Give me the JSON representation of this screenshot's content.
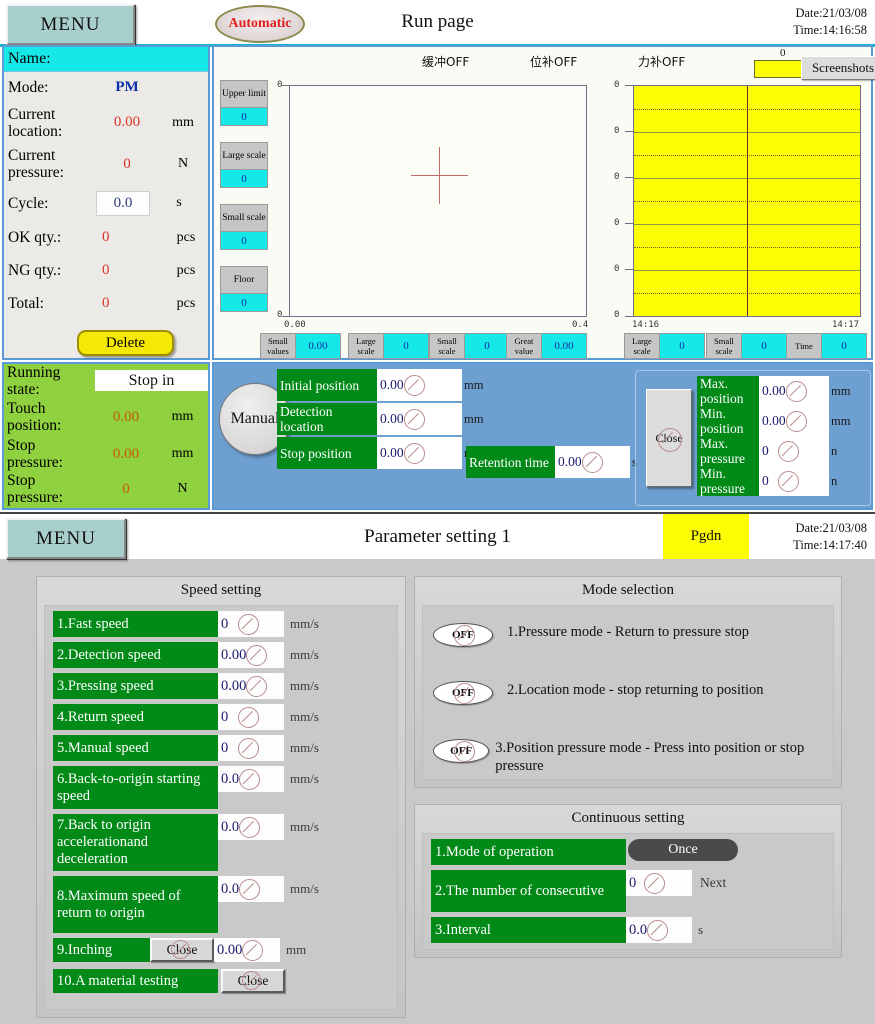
{
  "window1": {
    "menu_label": "MENU",
    "mode_button": "Automatic",
    "title": "Run page",
    "date_label": "Date:",
    "date_value": "21/03/08",
    "time_label": "Time:",
    "time_value": "14:16:58",
    "info": {
      "name_label": "Name:",
      "name_value": "",
      "rows": [
        {
          "label": "Mode:",
          "value": "PM",
          "unit": "",
          "style": "blue"
        },
        {
          "label": "Current location:",
          "value": "0.00",
          "unit": "mm",
          "style": "red"
        },
        {
          "label": "Current pressure:",
          "value": "0",
          "unit": "N",
          "style": "red"
        },
        {
          "label": "Cycle:",
          "value": "0.0",
          "unit": "s",
          "style": "box"
        },
        {
          "label": "OK qty.:",
          "value": "0",
          "unit": "pcs",
          "style": "red"
        },
        {
          "label": "NG qty.:",
          "value": "0",
          "unit": "pcs",
          "style": "red"
        },
        {
          "label": "Total:",
          "value": "0",
          "unit": "pcs",
          "style": "red"
        }
      ],
      "delete_label": "Delete"
    },
    "running": {
      "state_label": "Running state:",
      "state_value": "Stop in",
      "rows": [
        {
          "label": "Touch position:",
          "value": "0.00",
          "unit": "mm"
        },
        {
          "label": "Stop pressure:",
          "value": "0.00",
          "unit": "mm"
        },
        {
          "label": "Stop pressure:",
          "value": "0",
          "unit": "N"
        }
      ]
    },
    "chart_top_labels": [
      "缓冲OFF",
      "位补OFF",
      "力补OFF"
    ],
    "screenshots_label": "Screenshots",
    "screenshot_bar_value": "0",
    "side_buttons": [
      {
        "label": "Upper limit",
        "value": "0"
      },
      {
        "label": "Large scale",
        "value": "0"
      },
      {
        "label": "Small scale",
        "value": "0"
      },
      {
        "label": "Floor",
        "value": "0"
      }
    ],
    "left_readouts": [
      {
        "label": "Small values",
        "value": "0.00"
      },
      {
        "label": "Large scale",
        "value": "0"
      },
      {
        "label": "Small scale",
        "value": "0"
      },
      {
        "label": "Great value",
        "value": "0.00"
      }
    ],
    "right_readouts": [
      {
        "label": "Large scale",
        "value": "0"
      },
      {
        "label": "Small scale",
        "value": "0"
      },
      {
        "label": "Time",
        "value": "0"
      }
    ],
    "manual": {
      "button_label": "Manual",
      "fields": [
        {
          "label": "Initial position",
          "value": "0.00",
          "unit": "mm"
        },
        {
          "label": "Detection location",
          "value": "0.00",
          "unit": "mm"
        },
        {
          "label": "Stop position",
          "value": "0.00",
          "unit": "mm"
        },
        {
          "label": "Retention time",
          "value": "0.00",
          "unit": "s"
        }
      ]
    },
    "limits": {
      "close_label": "Close",
      "fields": [
        {
          "label": "Max. position",
          "value": "0.00",
          "unit": "mm"
        },
        {
          "label": "Min. position",
          "value": "0.00",
          "unit": "mm"
        },
        {
          "label": "Max. pressure",
          "value": "0",
          "unit": "n"
        },
        {
          "label": "Min. pressure",
          "value": "0",
          "unit": "n"
        }
      ]
    }
  },
  "chart_data": [
    {
      "type": "line",
      "name": "position-pressure-curve",
      "title": "",
      "xlabel": "",
      "ylabel": "",
      "x_ticks": [
        "0.00",
        "0.4"
      ],
      "y_ticks": [
        "0",
        "0"
      ],
      "xlim": [
        0.0,
        0.4
      ],
      "ylim": [
        0,
        0
      ],
      "grid": false,
      "series": [
        {
          "name": "cursor",
          "x": [
            0.2
          ],
          "y": [
            0
          ]
        }
      ],
      "annotations": [
        "crosshair marker at plot centre"
      ]
    },
    {
      "type": "area",
      "name": "pressure-time-trend",
      "title": "",
      "xlabel": "",
      "ylabel": "",
      "x_ticks": [
        "14:16",
        "14:17"
      ],
      "y_ticks": [
        "0",
        "0",
        "0",
        "0",
        "0",
        "0"
      ],
      "grid": true,
      "fill_color": "#fcfc04",
      "series": [
        {
          "name": "trend",
          "values": [
            0,
            0
          ]
        }
      ]
    }
  ],
  "window2": {
    "menu_label": "MENU",
    "title": "Parameter setting 1",
    "pgdn_label": "Pgdn",
    "date_label": "Date:",
    "date_value": "21/03/08",
    "time_label": "Time:",
    "time_value": "14:17:40",
    "speed": {
      "title": "Speed setting",
      "rows": [
        {
          "label": "1.Fast speed",
          "value": "0",
          "unit": "mm/s"
        },
        {
          "label": "2.Detection speed",
          "value": "0.00",
          "unit": "mm/s"
        },
        {
          "label": "3.Pressing speed",
          "value": "0.00",
          "unit": "mm/s"
        },
        {
          "label": "4.Return speed",
          "value": "0",
          "unit": "mm/s"
        },
        {
          "label": "5.Manual speed",
          "value": "0",
          "unit": "mm/s"
        },
        {
          "label": "6.Back-to-origin starting speed",
          "value": "0.0",
          "unit": "mm/s"
        },
        {
          "label": "7.Back to origin accelerationand deceleration",
          "value": "0.0",
          "unit": "mm/s"
        },
        {
          "label": "8.Maximum speed of return to origin",
          "value": "0.0",
          "unit": "mm/s"
        },
        {
          "label": "9.Inching",
          "value": "0.00",
          "unit": "mm",
          "button": "Close"
        },
        {
          "label": "10.A material testing",
          "value": "",
          "unit": "",
          "button": "Close"
        }
      ]
    },
    "mode": {
      "title": "Mode selection",
      "rows": [
        {
          "state": "OFF",
          "text": "1.Pressure mode - Return to pressure stop"
        },
        {
          "state": "OFF",
          "text": "2.Location mode - stop returning to position"
        },
        {
          "state": "OFF",
          "text": "3.Position pressure mode - Press into position or stop pressure"
        }
      ]
    },
    "continuous": {
      "title": "Continuous setting",
      "rows": [
        {
          "label": "1.Mode of operation",
          "button": "Once"
        },
        {
          "label": "2.The number of consecutive",
          "value": "0",
          "unit": "Next"
        },
        {
          "label": "3.Interval",
          "value": "0.0",
          "unit": "s"
        }
      ]
    }
  }
}
